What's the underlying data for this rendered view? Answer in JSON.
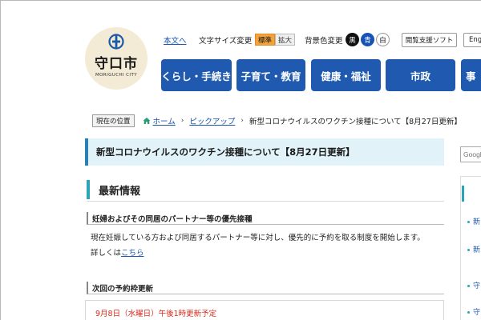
{
  "logo": {
    "name": "守口市",
    "en": "MORIGUCHI CITY"
  },
  "utility": {
    "skip_link": "本文へ",
    "font_size_label": "文字サイズ変更",
    "font_size_standard": "標準",
    "font_size_large": "拡大",
    "bg_color_label": "背景色変更",
    "bg_black": "黒",
    "bg_blue": "青",
    "bg_white": "白",
    "browse_assist": "閲覧支援ソフト",
    "lang": "Eng"
  },
  "nav": {
    "items": [
      {
        "label": "くらし・手続き"
      },
      {
        "label": "子育て・教育"
      },
      {
        "label": "健康・福祉"
      },
      {
        "label": "市政"
      },
      {
        "label": "事"
      }
    ]
  },
  "breadcrumb": {
    "here": "現在の位置",
    "home": "ホーム",
    "pickup": "ピックアップ",
    "current": "新型コロナウイルスのワクチン接種について【8月27日更新】"
  },
  "main": {
    "title": "新型コロナウイルスのワクチン接種について【8月27日更新】",
    "section_heading": "最新情報",
    "sub1_heading": "妊婦およびその同居のパートナー等の優先接種",
    "sub1_body": "現在妊娠している方および同居するパートナー等に対し、優先的に予約を取る制度を開始します。",
    "sub1_detail_prefix": "詳しくは",
    "sub1_detail_link": "こちら",
    "sub2_heading": "次回の予約枠更新",
    "notice": "9月8日（水曜日）午後1時更新予定"
  },
  "sidebar": {
    "search_placeholder": "Google",
    "items": [
      "新",
      "新",
      "守",
      "守"
    ]
  },
  "colors": {
    "nav_blue": "#1f5ab0",
    "title_bg": "#e1f3f9",
    "accent_teal": "#2aa6b8",
    "font_active": "#f2a33a",
    "notice_red": "#d92b1c"
  }
}
